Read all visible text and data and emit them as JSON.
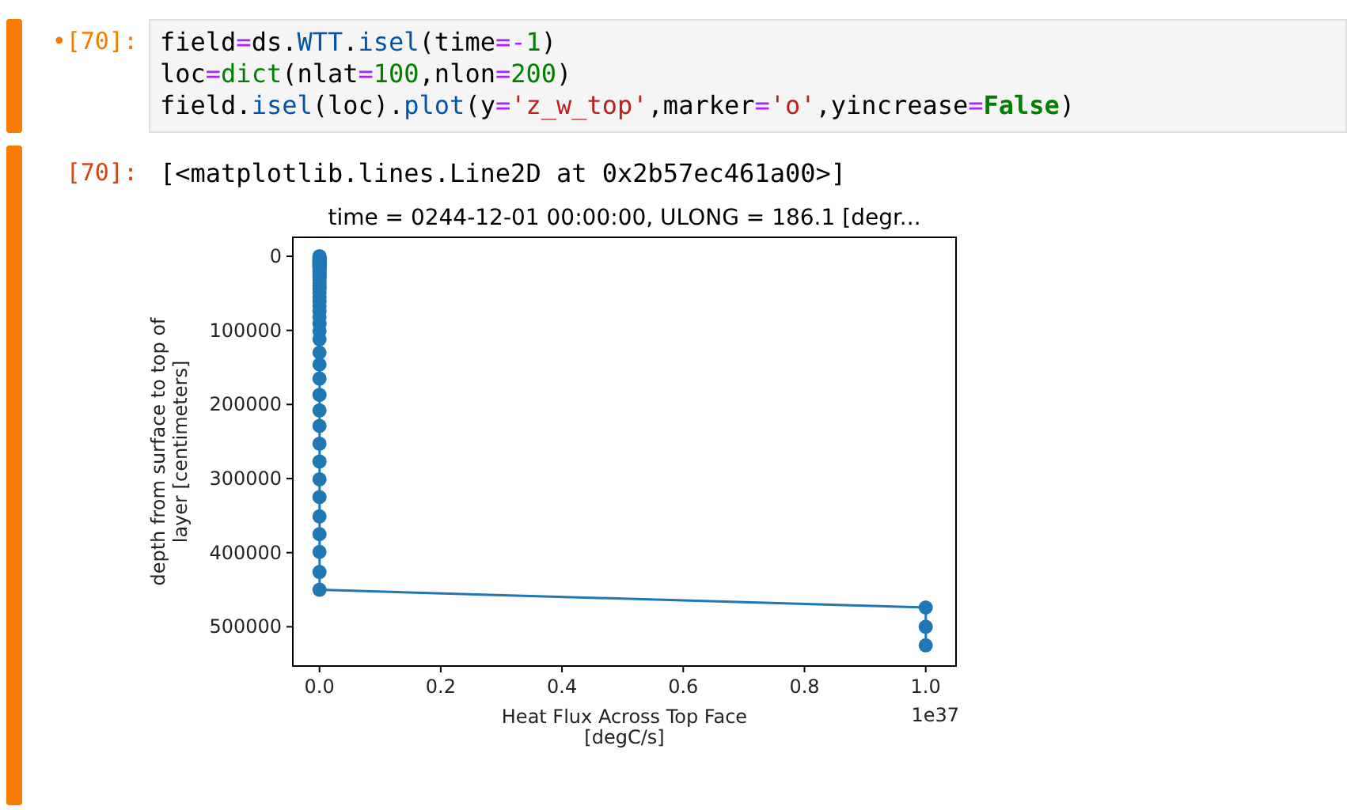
{
  "cells": [
    {
      "kind": "input",
      "prompt": "•[70]:",
      "code_lines": [
        [
          {
            "t": "field",
            "kind": "name"
          },
          {
            "t": "=",
            "kind": "op"
          },
          {
            "t": "ds",
            "kind": "name"
          },
          {
            "t": ".",
            "kind": "name"
          },
          {
            "t": "WTT",
            "kind": "attr"
          },
          {
            "t": ".",
            "kind": "name"
          },
          {
            "t": "isel",
            "kind": "attr"
          },
          {
            "t": "(time",
            "kind": "name"
          },
          {
            "t": "=-",
            "kind": "op"
          },
          {
            "t": "1",
            "kind": "number"
          },
          {
            "t": ")",
            "kind": "name"
          }
        ],
        [
          {
            "t": "loc",
            "kind": "name"
          },
          {
            "t": "=",
            "kind": "op"
          },
          {
            "t": "dict",
            "kind": "builtin"
          },
          {
            "t": "(nlat",
            "kind": "name"
          },
          {
            "t": "=",
            "kind": "op"
          },
          {
            "t": "100",
            "kind": "number"
          },
          {
            "t": ",nlon",
            "kind": "name"
          },
          {
            "t": "=",
            "kind": "op"
          },
          {
            "t": "200",
            "kind": "number"
          },
          {
            "t": ")",
            "kind": "name"
          }
        ],
        [
          {
            "t": "field",
            "kind": "name"
          },
          {
            "t": ".",
            "kind": "name"
          },
          {
            "t": "isel",
            "kind": "attr"
          },
          {
            "t": "(loc)",
            "kind": "name"
          },
          {
            "t": ".",
            "kind": "name"
          },
          {
            "t": "plot",
            "kind": "attr"
          },
          {
            "t": "(y",
            "kind": "name"
          },
          {
            "t": "=",
            "kind": "op"
          },
          {
            "t": "'z_w_top'",
            "kind": "string"
          },
          {
            "t": ",marker",
            "kind": "name"
          },
          {
            "t": "=",
            "kind": "op"
          },
          {
            "t": "'o'",
            "kind": "string"
          },
          {
            "t": ",yincrease",
            "kind": "name"
          },
          {
            "t": "=",
            "kind": "op"
          },
          {
            "t": "False",
            "kind": "keyword"
          },
          {
            "t": ")",
            "kind": "name"
          }
        ]
      ]
    },
    {
      "kind": "output",
      "prompt": "[70]:",
      "text": "[<matplotlib.lines.Line2D at 0x2b57ec461a00>]",
      "chart_data": {
        "type": "line",
        "orientation": "horizontal",
        "title": "time = 0244-12-01 00:00:00, ULONG = 186.1 [degr...",
        "xlabel": "Heat Flux Across Top Face\n[degC/s]",
        "ylabel": "depth from surface to top of\nlayer [centimeters]",
        "x": [
          0,
          1000,
          2000,
          3000,
          4000,
          5000,
          6000,
          7000,
          8000,
          9000,
          10000,
          11000,
          12000,
          13000,
          14000,
          15000,
          17000,
          19000,
          21000,
          24000,
          26000,
          29000,
          32000,
          36000,
          40000,
          44000,
          49000,
          55000,
          61000,
          67000,
          74000,
          82000,
          91000,
          101000,
          112000,
          130000,
          146000,
          165000,
          187000,
          208000,
          229000,
          253000,
          277000,
          301000,
          325000,
          351000,
          375000,
          399000,
          426000,
          450000,
          474000,
          500000,
          525000
        ],
        "series": [
          {
            "color": "#1f77b4",
            "marker": "o",
            "values": [
              0,
              0,
              0,
              0,
              0,
              0,
              0,
              0,
              0,
              0,
              0,
              0,
              0,
              0,
              0,
              0,
              0,
              0,
              0,
              0,
              0,
              0,
              0,
              0,
              0,
              0,
              0,
              0,
              0,
              0,
              0,
              0,
              0,
              0,
              0,
              0,
              0,
              0,
              0,
              0,
              0,
              0,
              0,
              0,
              0,
              0,
              0,
              0,
              0,
              0,
              1,
              1,
              1
            ]
          }
        ],
        "xlim": [
          -0.044,
          1.05
        ],
        "ylim": [
          553000,
          -25600
        ],
        "xticks": [
          {
            "value": 0,
            "label": "0.0"
          },
          {
            "value": 0.2,
            "label": "0.2"
          },
          {
            "value": 0.4,
            "label": "0.4"
          },
          {
            "value": 0.6,
            "label": "0.6"
          },
          {
            "value": 0.8,
            "label": "0.8"
          },
          {
            "value": 1,
            "label": "1.0"
          }
        ],
        "yticks": [
          0,
          100000,
          200000,
          300000,
          400000,
          500000
        ],
        "annotations": [
          "1e37"
        ]
      }
    }
  ]
}
